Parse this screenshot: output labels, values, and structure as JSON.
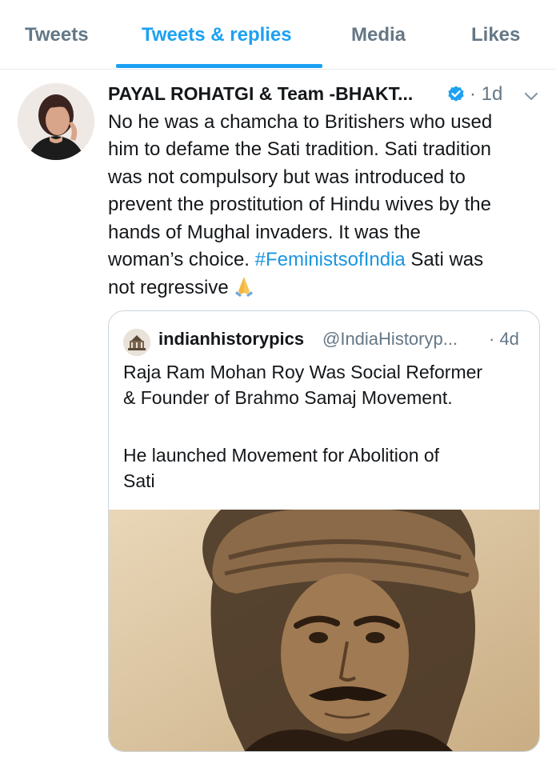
{
  "tabs": [
    {
      "label": "Tweets",
      "active": false
    },
    {
      "label": "Tweets & replies",
      "active": true
    },
    {
      "label": "Media",
      "active": false
    },
    {
      "label": "Likes",
      "active": false
    }
  ],
  "tweet": {
    "author": "PAYAL ROHATGI & Team -BHAKT...",
    "verified": true,
    "time": "· 1d",
    "text_lines": [
      "No he was a chamcha to Britishers who used",
      "him to defame the Sati tradition. Sati tradition",
      "was not compulsory but was introduced to",
      "prevent the prostitution of Hindu wives by the",
      "hands of Mughal invaders. It was the"
    ],
    "text_line6_prefix": "woman’s choice. ",
    "hashtag": "#FeministsofIndia",
    "text_line6_suffix": " Sati was",
    "text_line7": "not regressive",
    "emoji": "folded-hands"
  },
  "quoted_tweet": {
    "name": "indianhistorypics",
    "handle": "@IndiaHistoryp...",
    "time": "· 4d",
    "text_lines": [
      "Raja Ram Mohan Roy Was Social Reformer",
      "& Founder of Brahmo Samaj Movement."
    ],
    "text_lines_2": [
      "He launched Movement for Abolition of",
      "Sati"
    ]
  },
  "colors": {
    "accent": "#1da1f2",
    "hashtag": "#1b95e0",
    "secondary_text": "#657786",
    "border": "#ccd6dd"
  }
}
